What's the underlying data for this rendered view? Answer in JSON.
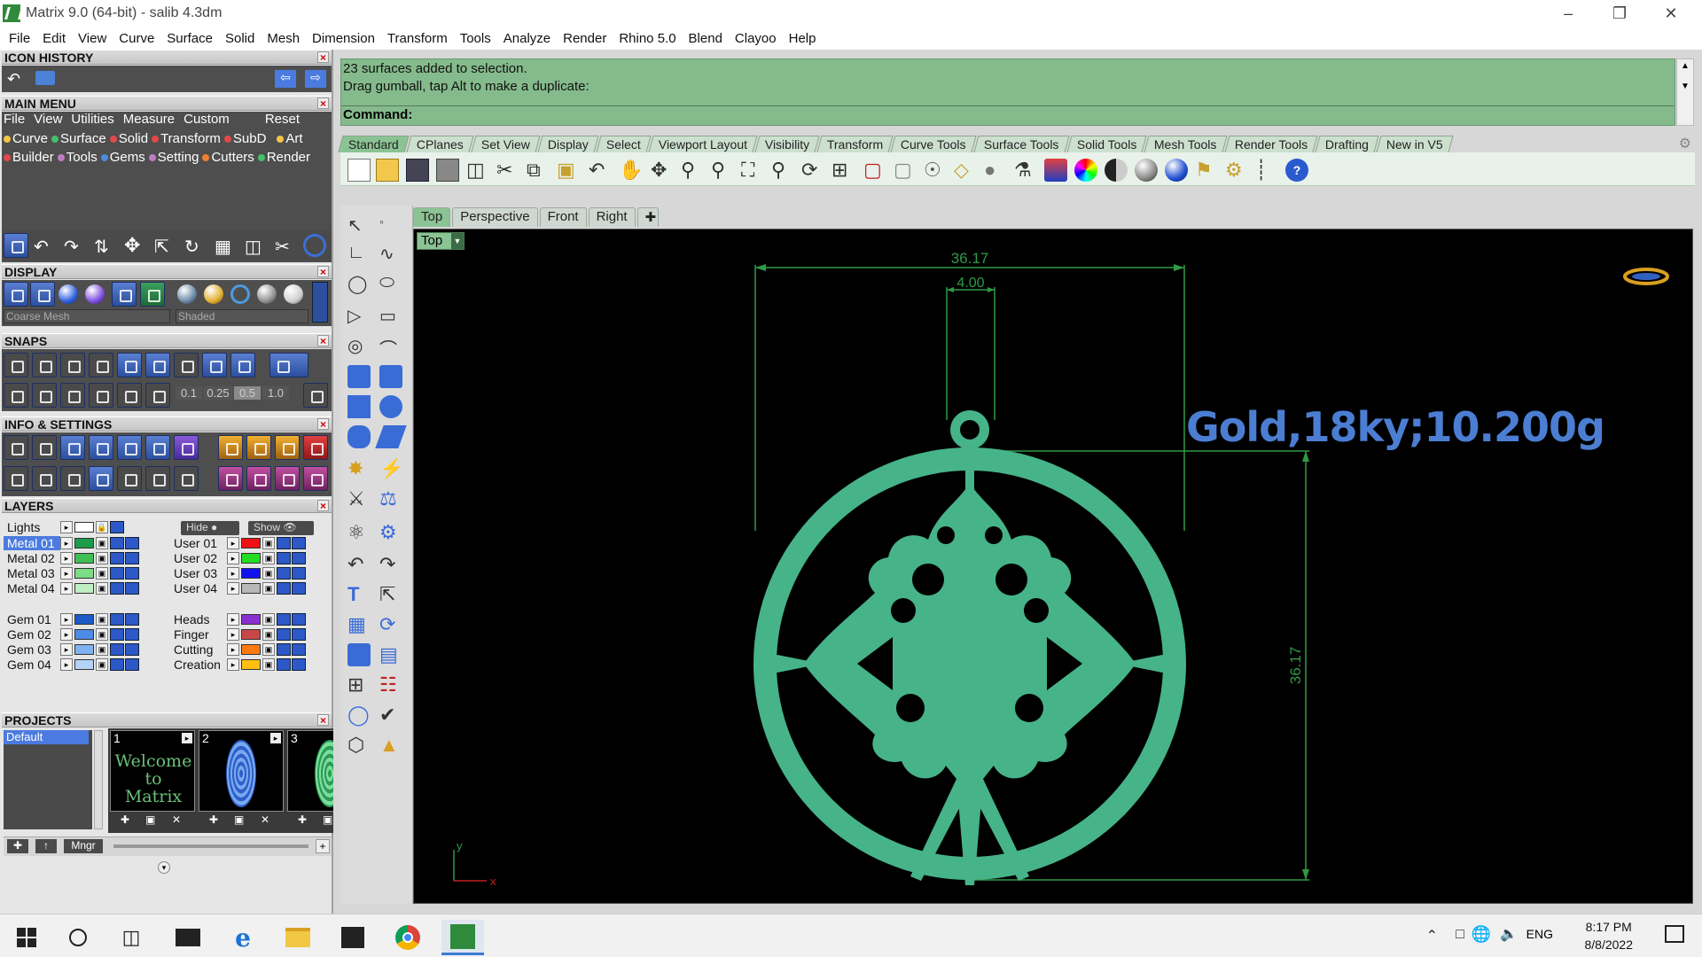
{
  "window": {
    "title": "Matrix 9.0 (64-bit) - salib 4.3dm"
  },
  "menubar": [
    "File",
    "Edit",
    "View",
    "Curve",
    "Surface",
    "Solid",
    "Mesh",
    "Dimension",
    "Transform",
    "Tools",
    "Analyze",
    "Render",
    "Rhino 5.0",
    "Blend",
    "Clayoo",
    "Help"
  ],
  "left_panel": {
    "icon_history": "ICON HISTORY",
    "main_menu": "MAIN MENU",
    "main_menu_bar": [
      "File",
      "View",
      "Utilities",
      "Measure",
      "Custom",
      "Reset"
    ],
    "main_menu_row1": [
      "Curve",
      "Surface",
      "Solid",
      "Transform",
      "SubD",
      "Art"
    ],
    "main_menu_row2": [
      "Builder",
      "Tools",
      "Gems",
      "Setting",
      "Cutters",
      "Render"
    ],
    "display": "DISPLAY",
    "display_mesh": "Coarse Mesh",
    "display_mode": "Shaded",
    "snaps": "SNAPS",
    "snap_values": [
      "0.1",
      "0.25",
      "0.5",
      "1.0"
    ],
    "info_settings": "INFO & SETTINGS",
    "layers_title": "LAYERS",
    "lights": "Lights",
    "hide": "Hide",
    "show": "Show",
    "layers_left": [
      {
        "name": "Metal 01",
        "color": "#1e9a4b",
        "selected": true
      },
      {
        "name": "Metal 02",
        "color": "#3fbf55"
      },
      {
        "name": "Metal 03",
        "color": "#7ddc86"
      },
      {
        "name": "Metal 04",
        "color": "#bfeec3"
      },
      {
        "name": "Gem 01",
        "color": "#1d5ac6"
      },
      {
        "name": "Gem 02",
        "color": "#4c8be6"
      },
      {
        "name": "Gem 03",
        "color": "#7fb2f0"
      },
      {
        "name": "Gem 04",
        "color": "#b3d4f7"
      }
    ],
    "layers_right": [
      {
        "name": "User 01",
        "color": "#ee1111"
      },
      {
        "name": "User 02",
        "color": "#22dd22"
      },
      {
        "name": "User 03",
        "color": "#1111ee"
      },
      {
        "name": "User 04",
        "color": "#b8b8b8"
      },
      {
        "name": "Heads",
        "color": "#8a2ed0"
      },
      {
        "name": "Finger",
        "color": "#c84848"
      },
      {
        "name": "Cutting",
        "color": "#ff7a10"
      },
      {
        "name": "Creation",
        "color": "#ffbf10"
      }
    ],
    "projects_title": "PROJECTS",
    "project_default": "Default",
    "project_thumbs": [
      "1",
      "2",
      "3"
    ],
    "thumb1_text": "Welcome to Matrix",
    "mngr": "Mngr"
  },
  "command": {
    "line1": "23 surfaces added to selection.",
    "line2": "Drag gumball, tap Alt to make a duplicate:",
    "prompt": "Command:"
  },
  "toolbar_tabs": [
    "Standard",
    "CPlanes",
    "Set View",
    "Display",
    "Select",
    "Viewport Layout",
    "Visibility",
    "Transform",
    "Curve Tools",
    "Surface Tools",
    "Solid Tools",
    "Mesh Tools",
    "Render Tools",
    "Drafting",
    "New in V5"
  ],
  "viewport_tabs": [
    "Top",
    "Perspective",
    "Front",
    "Right"
  ],
  "viewport": {
    "label": "Top",
    "dim_top": "36.17",
    "dim_hole": "4.00",
    "dim_side": "36.17",
    "material": "Gold,18ky;10.200g",
    "axis_x": "x",
    "axis_y": "y"
  },
  "taskbar": {
    "lang": "ENG",
    "time": "8:17 PM",
    "date": "8/8/2022"
  },
  "colors": {
    "pendant": "#46b389",
    "dimension": "#2f9a46",
    "command_bg": "#85bb8c",
    "gold_text": "#4b7ed2"
  }
}
